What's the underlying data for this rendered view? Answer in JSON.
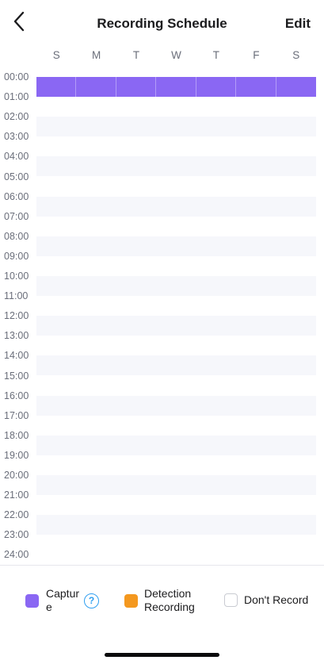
{
  "header": {
    "title": "Recording Schedule",
    "edit_label": "Edit",
    "back_icon": "chevron-left-icon"
  },
  "days": [
    "S",
    "M",
    "T",
    "W",
    "T",
    "F",
    "S"
  ],
  "hours": [
    "00:00",
    "01:00",
    "02:00",
    "03:00",
    "04:00",
    "05:00",
    "06:00",
    "07:00",
    "08:00",
    "09:00",
    "10:00",
    "11:00",
    "12:00",
    "13:00",
    "14:00",
    "15:00",
    "16:00",
    "17:00",
    "18:00",
    "19:00",
    "20:00",
    "21:00",
    "22:00",
    "23:00",
    "24:00"
  ],
  "schedule": {
    "capture_hours": [
      "00:00-01:00"
    ]
  },
  "legend": {
    "capture_label_line1": "Captur",
    "capture_label_line2": "e",
    "help_icon": "?",
    "detection_label_line1": "Detection",
    "detection_label_line2": "Recording",
    "dont_record_label": "Don't Record"
  },
  "colors": {
    "capture": "#8a67f3",
    "detection": "#f4981f",
    "help": "#2f9ff0"
  }
}
